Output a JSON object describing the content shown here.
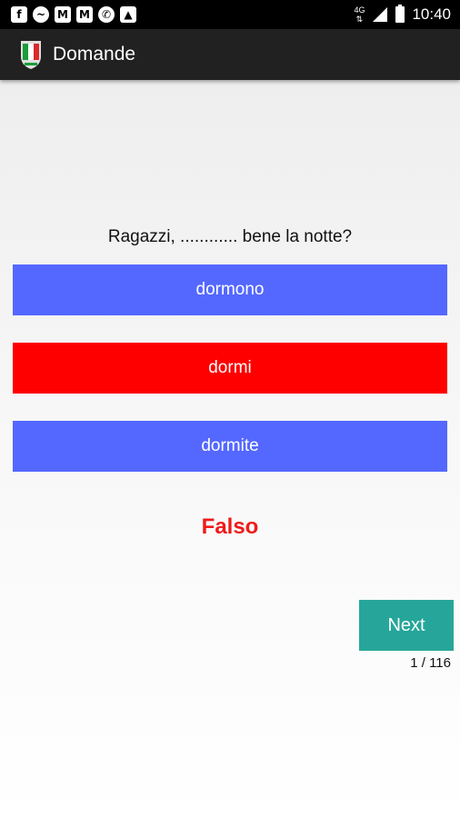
{
  "status_bar": {
    "icons": [
      "facebook-icon",
      "messenger-icon",
      "gmail-icon",
      "gmail-icon",
      "whatsapp-icon",
      "image-icon"
    ],
    "network": "4G",
    "time": "10:40"
  },
  "app_bar": {
    "title": "Domande",
    "icon": "italy-flag-shield-icon"
  },
  "quiz": {
    "question": "Ragazzi, ............ bene la notte?",
    "answers": [
      {
        "label": "dormono",
        "color": "#5468ff"
      },
      {
        "label": "dormi",
        "color": "#ff0000"
      },
      {
        "label": "dormite",
        "color": "#5468ff"
      }
    ],
    "result": "Falso",
    "result_color": "#f01a1a",
    "next_label": "Next",
    "progress": "1 / 116"
  },
  "colors": {
    "status_bar": "#000000",
    "app_bar": "#212121",
    "next_button": "#26a69a"
  }
}
